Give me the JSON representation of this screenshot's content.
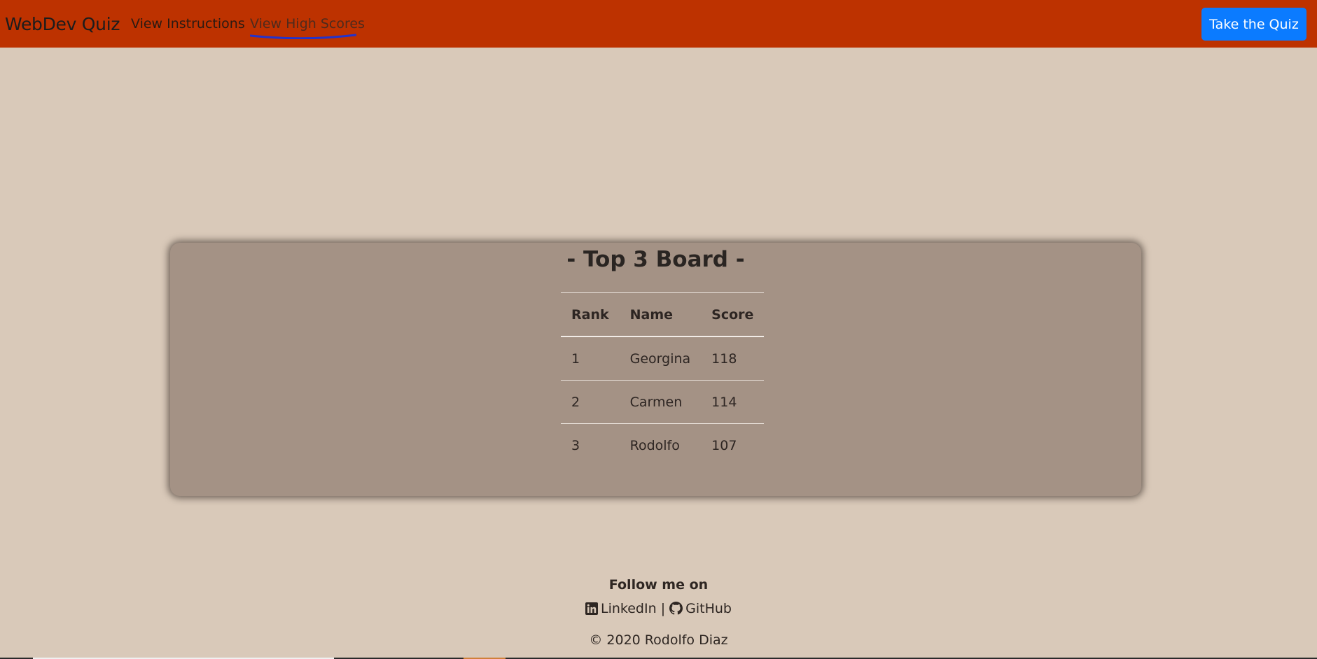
{
  "navbar": {
    "brand": "WebDev Quiz",
    "links": [
      {
        "label": "View Instructions"
      },
      {
        "label": "View High Scores"
      }
    ],
    "cta_label": "Take the Quiz",
    "colors": {
      "background": "#bd3200",
      "cta": "#0b7bff",
      "underline": "#2233cc"
    }
  },
  "board": {
    "title": "- Top 3 Board -",
    "columns": [
      "Rank",
      "Name",
      "Score"
    ],
    "rows": [
      {
        "rank": "1",
        "name": "Georgina",
        "score": "118"
      },
      {
        "rank": "2",
        "name": "Carmen",
        "score": "114"
      },
      {
        "rank": "3",
        "name": "Rodolfo",
        "score": "107"
      }
    ]
  },
  "footer": {
    "follow": "Follow me on",
    "linkedin": "LinkedIn",
    "separator": "|",
    "github": "GitHub",
    "copyright": "© 2020 Rodolfo Diaz",
    "icons": [
      "linkedin-icon",
      "github-icon"
    ]
  }
}
